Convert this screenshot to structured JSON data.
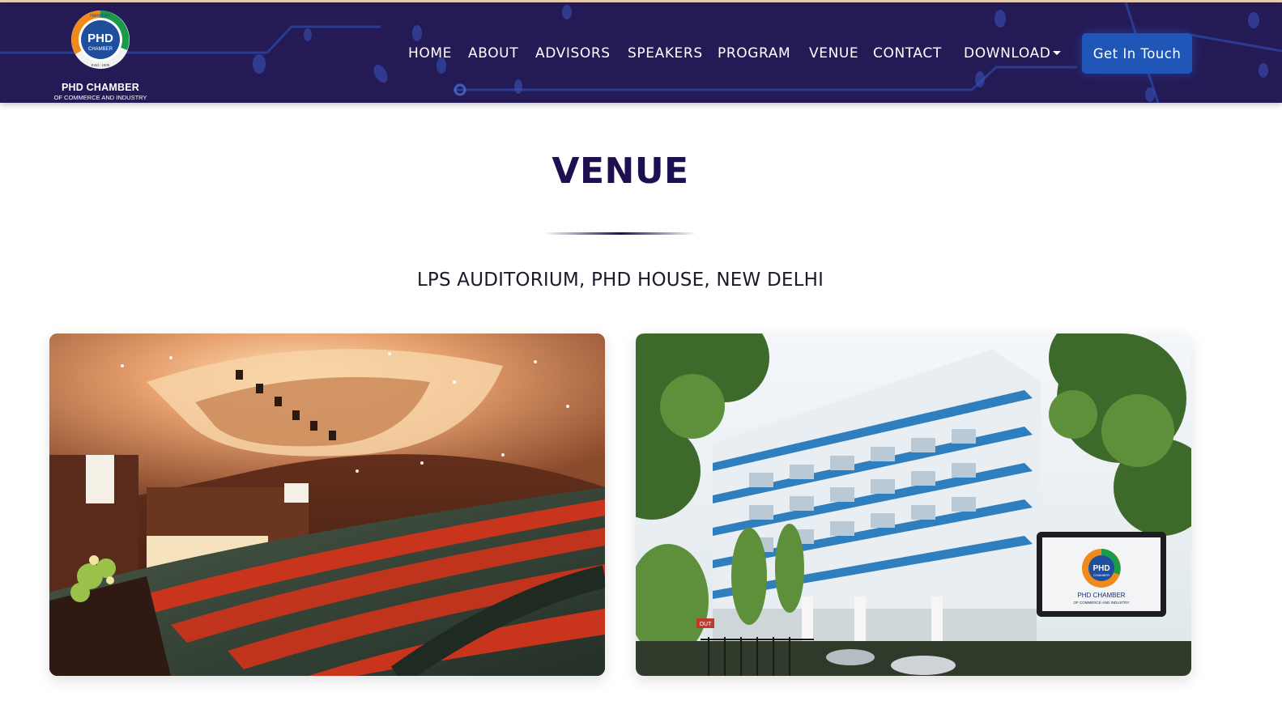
{
  "header": {
    "logo": {
      "badge_text": "PHD",
      "badge_sub": "CHAMBER",
      "ring_words": [
        "HARMONY",
        "PROGRESS",
        "DEVELOPMENT"
      ],
      "estd": "Estd.: 1905",
      "name": "PHD CHAMBER",
      "tagline": "OF COMMERCE AND INDUSTRY"
    },
    "nav": [
      {
        "label": "HOME"
      },
      {
        "label": "ABOUT"
      },
      {
        "label": "ADVISORS"
      },
      {
        "label": "SPEAKERS"
      },
      {
        "label": "PROGRAM"
      },
      {
        "label": "VENUE"
      },
      {
        "label": "CONTACT"
      },
      {
        "label": "DOWNLOAD",
        "has_dropdown": true
      }
    ],
    "cta_label": "Get In Touch"
  },
  "section": {
    "title": "VENUE",
    "location": "LPS AUDITORIUM, PHD HOUSE, NEW DELHI"
  },
  "photos": {
    "building_sign": {
      "badge_text": "PHD",
      "badge_sub": "CHAMBER",
      "name": "PHD CHAMBER",
      "tagline": "OF COMMERCE AND INDUSTRY"
    },
    "exit_sign": "OUT"
  },
  "colors": {
    "header_bg": "#241a55",
    "cta_bg": "#1f56b8",
    "title": "#1e1050",
    "logo_orange": "#f18a1c",
    "logo_green": "#1a9b4a",
    "logo_blue": "#1f4e9c"
  }
}
